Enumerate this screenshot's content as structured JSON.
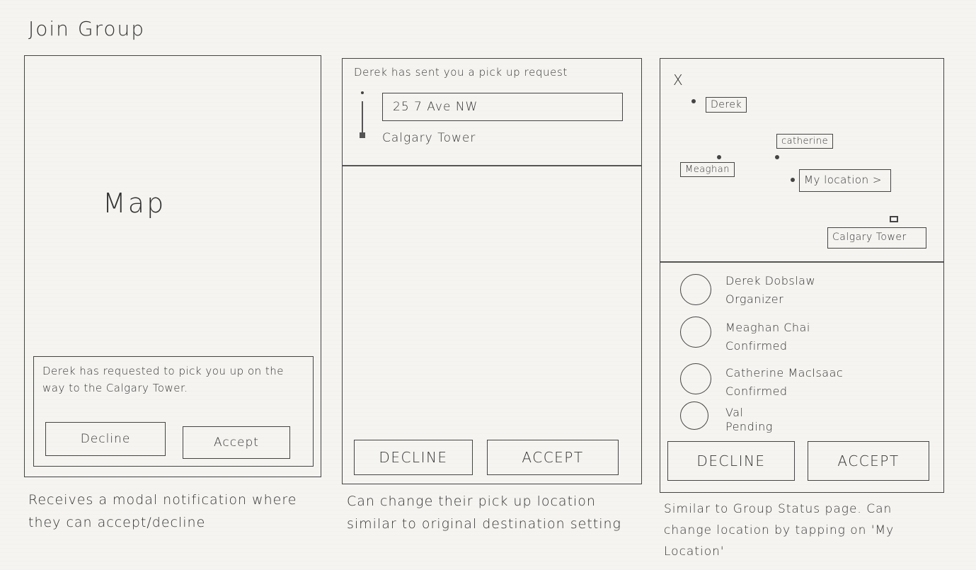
{
  "title": "Join Group",
  "screen1": {
    "map_label": "Map",
    "modal_text": "Derek has requested to pick you up on the way to the Calgary Tower.",
    "decline_label": "Decline",
    "accept_label": "Accept",
    "caption": "Receives a modal notification where they can accept/decline"
  },
  "screen2": {
    "header_text": "Derek has sent you a pick up request",
    "origin_value": "25 7 Ave NW",
    "destination_text": "Calgary Tower",
    "decline_label": "DECLINE",
    "accept_label": "ACCEPT",
    "caption": "Can change their pick up location similar to original destination setting"
  },
  "screen3": {
    "close_label": "X",
    "map_tags": {
      "derek": "Derek",
      "catherine": "catherine",
      "meaghan": "Meaghan",
      "my_location": "My location >",
      "calgary_tower": "Calgary Tower"
    },
    "members": [
      {
        "name": "Derek Dobslaw",
        "status": "Organizer"
      },
      {
        "name": "Meaghan Chai",
        "status": "Confirmed"
      },
      {
        "name": "Catherine MacIsaac",
        "status": "Confirmed"
      },
      {
        "name": "Val",
        "status": "Pending"
      }
    ],
    "decline_label": "DECLINE",
    "accept_label": "ACCEPT",
    "caption": "Similar to Group Status page. Can change location by tapping on 'My Location'"
  }
}
